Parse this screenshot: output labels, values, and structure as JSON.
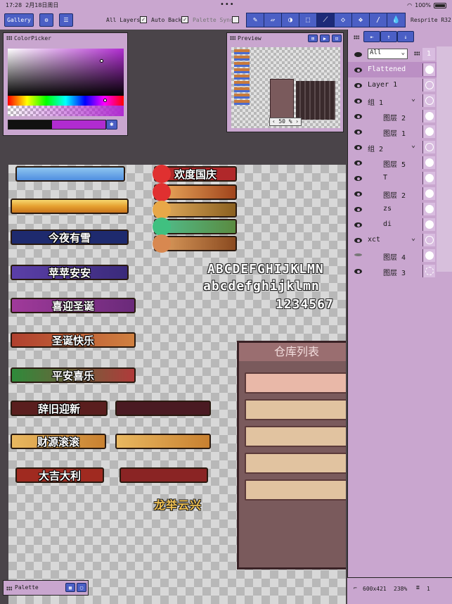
{
  "status": {
    "time": "17:28",
    "date": "2月18日周日",
    "battery": "100%",
    "dots": "•••"
  },
  "toolbar": {
    "gallery": "Gallery",
    "all_layers": "All Layers",
    "auto_back": "Auto Back",
    "palette_sync": "Palette Sync",
    "brand": "Resprite R32",
    "check": "✓"
  },
  "colorpicker": {
    "title": "ColorPicker"
  },
  "preview": {
    "title": "Preview",
    "zoom": "50 %",
    "prev": "‹",
    "next": "›"
  },
  "layers": {
    "filter": "All",
    "filter_badge": "1",
    "items": [
      {
        "name": "Flattened",
        "selected": true,
        "eye": "open",
        "thumb": "full"
      },
      {
        "name": "Layer 1",
        "eye": "open",
        "thumb": "empty"
      },
      {
        "name": "组 1",
        "eye": "open",
        "group": true,
        "chev": "⌄",
        "thumb": "empty"
      },
      {
        "name": "图层 2",
        "eye": "open",
        "indent": true,
        "thumb": "full"
      },
      {
        "name": "图层 1",
        "eye": "open",
        "indent": true,
        "thumb": "full"
      },
      {
        "name": "组 2",
        "eye": "open",
        "group": true,
        "chev": "⌄",
        "thumb": "empty"
      },
      {
        "name": "图层 5",
        "eye": "open",
        "indent": true,
        "thumb": "full"
      },
      {
        "name": "T",
        "eye": "open",
        "indent": true,
        "thumb": "full"
      },
      {
        "name": "图层 2",
        "eye": "open",
        "indent": true,
        "thumb": "full"
      },
      {
        "name": "zs",
        "eye": "open",
        "indent": true,
        "thumb": "full"
      },
      {
        "name": "di",
        "eye": "open",
        "indent": true,
        "thumb": "full"
      },
      {
        "name": "xct",
        "eye": "open",
        "group": true,
        "chev": "⌄",
        "thumb": "empty"
      },
      {
        "name": "图层 4",
        "eye": "closed",
        "indent": true,
        "thumb": "full"
      },
      {
        "name": "图层 3",
        "eye": "open",
        "indent": true,
        "thumb": "dashed"
      }
    ]
  },
  "canvas_content": {
    "banners": [
      "欢度国庆",
      "今夜有雪",
      "苹苹安安",
      "喜迎圣诞",
      "圣诞快乐",
      "平安喜乐",
      "辞旧迎新",
      "财源滚滚",
      "大吉大利"
    ],
    "motto": "龙举云兴",
    "font_upper": "ABCDEFGHIJKLMN",
    "font_lower": "abcdefghijklmn",
    "font_digits": "1234567",
    "warehouse_title": "仓库列表"
  },
  "footer": {
    "size": "600x421",
    "zoom": "238%",
    "layer_count": "1"
  },
  "palette": {
    "title": "Palette"
  },
  "colors": {
    "ui_bg": "#c9a6cf",
    "button_blue": "#4b5fc5",
    "workspace": "#4a4449"
  }
}
